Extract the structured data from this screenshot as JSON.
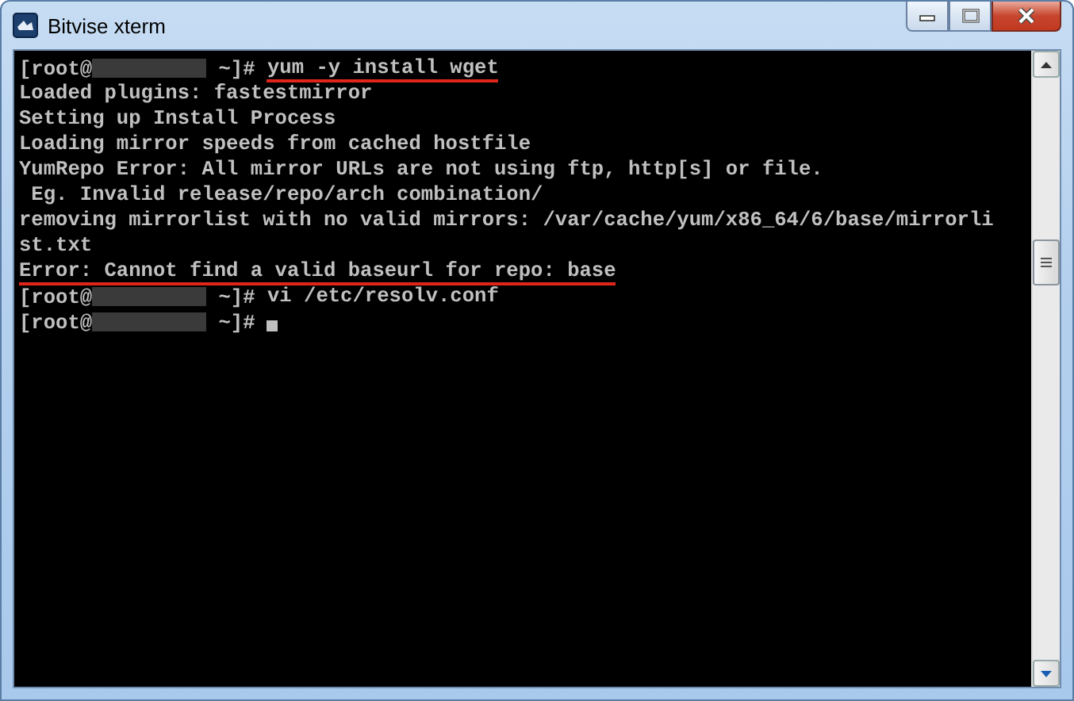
{
  "window": {
    "title": "Bitvise xterm"
  },
  "terminal": {
    "lines": [
      {
        "kind": "prompt",
        "prefix": "[root@",
        "suffix": " ~]# ",
        "command": "yum -y install wget",
        "underlined": true
      },
      {
        "kind": "output",
        "text": "Loaded plugins: fastestmirror",
        "underlined": false
      },
      {
        "kind": "output",
        "text": "Setting up Install Process",
        "underlined": false
      },
      {
        "kind": "output",
        "text": "Loading mirror speeds from cached hostfile",
        "underlined": false
      },
      {
        "kind": "output",
        "text": "YumRepo Error: All mirror URLs are not using ftp, http[s] or file.",
        "underlined": false
      },
      {
        "kind": "output",
        "text": " Eg. Invalid release/repo/arch combination/",
        "underlined": false
      },
      {
        "kind": "output",
        "text": "removing mirrorlist with no valid mirrors: /var/cache/yum/x86_64/6/base/mirrorli",
        "underlined": false
      },
      {
        "kind": "output",
        "text": "st.txt",
        "underlined": false
      },
      {
        "kind": "output",
        "text": "Error: Cannot find a valid baseurl for repo: base",
        "underlined": true
      },
      {
        "kind": "prompt",
        "prefix": "[root@",
        "suffix": " ~]# ",
        "command": "vi /etc/resolv.conf",
        "underlined": false
      },
      {
        "kind": "prompt",
        "prefix": "[root@",
        "suffix": " ~]# ",
        "cursor": true
      }
    ]
  }
}
